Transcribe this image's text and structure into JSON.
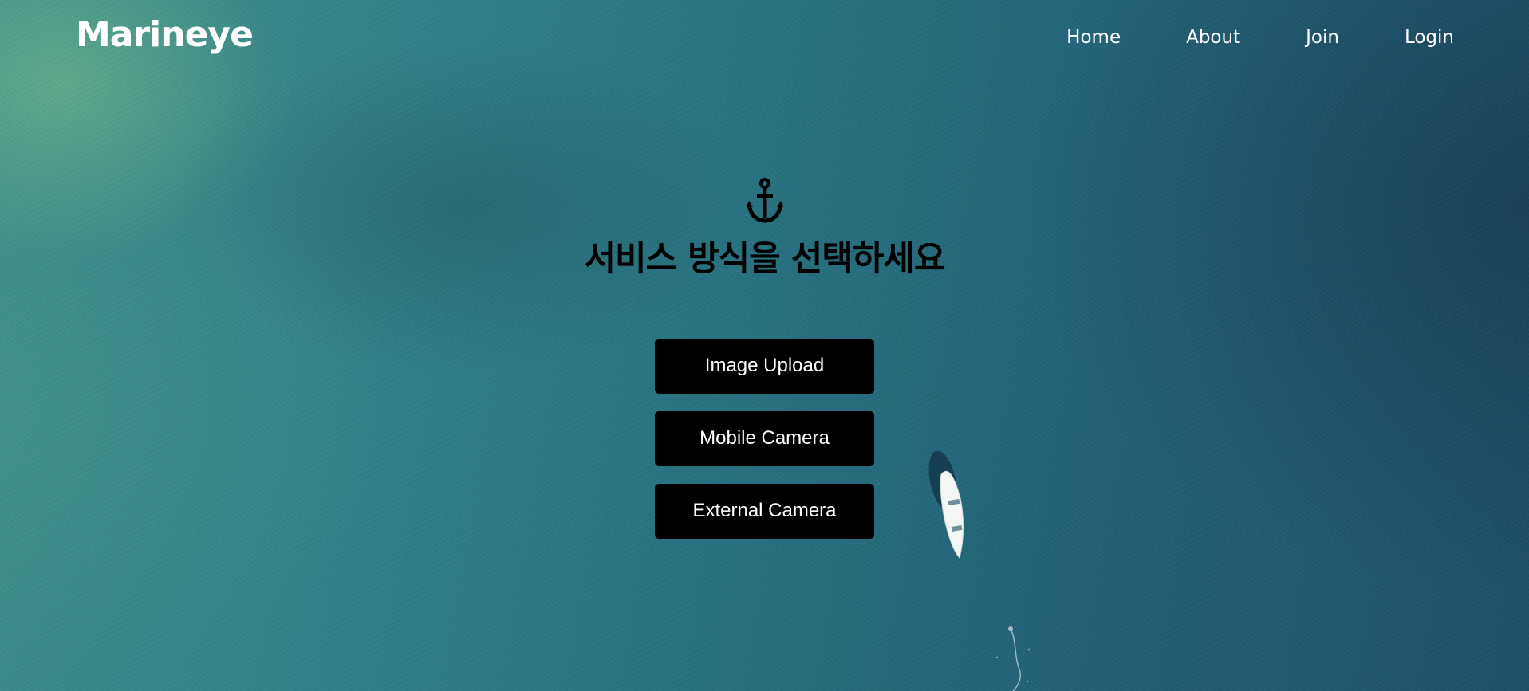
{
  "brand": {
    "name": "Marineye"
  },
  "nav": {
    "items": [
      {
        "label": "Home"
      },
      {
        "label": "About"
      },
      {
        "label": "Join"
      },
      {
        "label": "Login"
      }
    ]
  },
  "main": {
    "icon": "anchor-icon",
    "heading": "서비스 방식을 선택하세요",
    "options": [
      {
        "label": "Image Upload"
      },
      {
        "label": "Mobile Camera"
      },
      {
        "label": "External Camera"
      }
    ]
  },
  "colors": {
    "button_bg": "#000000",
    "button_text": "#ffffff",
    "nav_text": "#ffffff",
    "heading_text": "#000000"
  }
}
